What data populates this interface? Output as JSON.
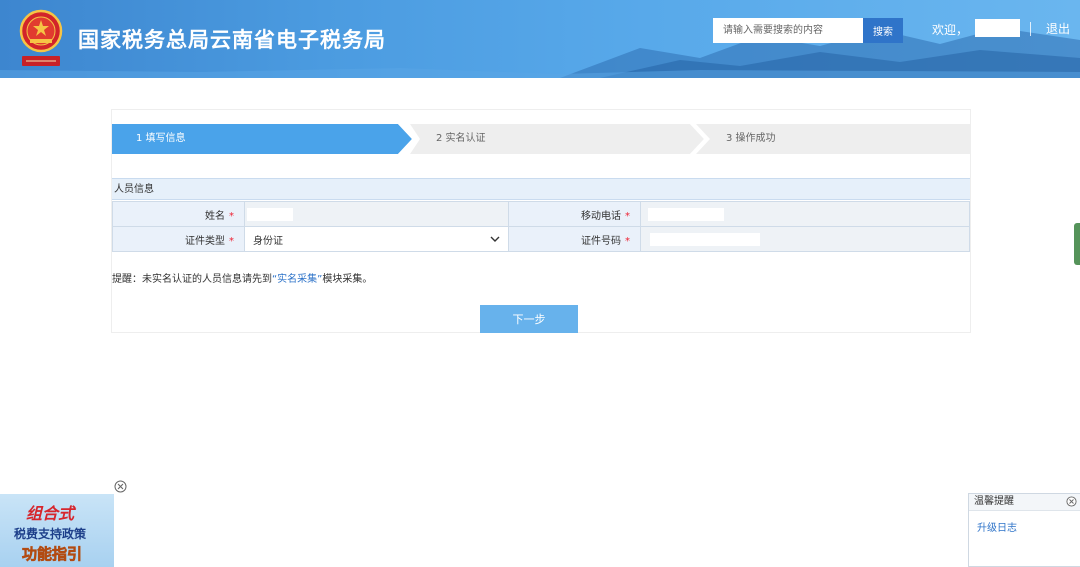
{
  "header": {
    "site_title": "国家税务总局云南省电子税务局",
    "search_placeholder": "请输入需要搜索的内容",
    "search_button": "搜索",
    "welcome": "欢迎，",
    "logout": "退出",
    "colors": {
      "brand": "#3d86cf",
      "search_button": "#2f74c9"
    }
  },
  "steps": [
    {
      "label": "1  填写信息",
      "active": true
    },
    {
      "label": "2  实名认证",
      "active": false
    },
    {
      "label": "3  操作成功",
      "active": false
    }
  ],
  "form": {
    "section_title": "人员信息",
    "fields": {
      "name_label": "姓名",
      "phone_label": "移动电话",
      "id_type_label": "证件类型",
      "id_type_value": "身份证",
      "id_number_label": "证件号码",
      "required_mark": "*"
    }
  },
  "notice": {
    "prefix": "提醒：未实名认证的人员信息请先到",
    "link": "“实名采集”",
    "suffix": "模块采集。"
  },
  "next_button": "下一步",
  "ad": {
    "line1": "组合式",
    "line2": "税费支持政策",
    "line3": "功能指引"
  },
  "tip_box": {
    "title": "温馨提醒",
    "link": "升级日志"
  }
}
